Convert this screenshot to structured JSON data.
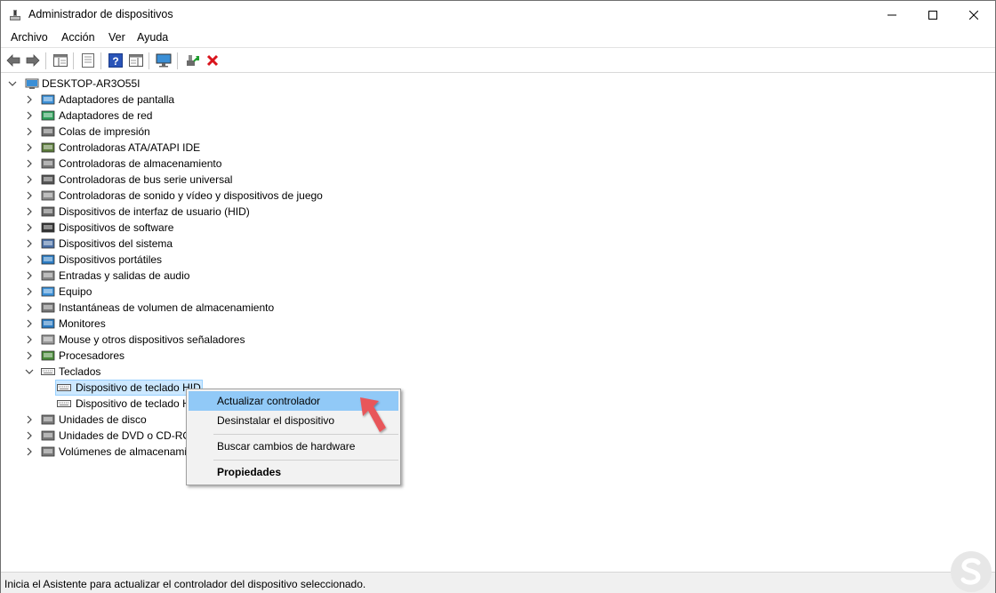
{
  "window": {
    "title": "Administrador de dispositivos"
  },
  "menu": [
    "Archivo",
    "Acción",
    "Ver",
    "Ayuda"
  ],
  "toolbar": {
    "buttons": [
      "back-icon",
      "forward-icon",
      "show-hide-console-tree-icon",
      "properties-icon",
      "help-icon",
      "action-pane-icon",
      "monitor-icon",
      "update-driver-icon",
      "uninstall-icon"
    ]
  },
  "tree": {
    "root": "DESKTOP-AR3O55I",
    "categories": [
      "Adaptadores de pantalla",
      "Adaptadores de red",
      "Colas de impresión",
      "Controladoras ATA/ATAPI IDE",
      "Controladoras de almacenamiento",
      "Controladoras de bus serie universal",
      "Controladoras de sonido y vídeo y dispositivos de juego",
      "Dispositivos de interfaz de usuario (HID)",
      "Dispositivos de software",
      "Dispositivos del sistema",
      "Dispositivos portátiles",
      "Entradas y salidas de audio",
      "Equipo",
      "Instantáneas de volumen de almacenamiento",
      "Monitores",
      "Mouse y otros dispositivos señaladores",
      "Procesadores",
      "Teclados"
    ],
    "keyboard_children": [
      "Dispositivo de teclado HID",
      "Dispositivo de teclado H"
    ],
    "after": [
      "Unidades de disco",
      "Unidades de DVD o CD-ROM",
      "Volúmenes de almacenami"
    ]
  },
  "context_menu": {
    "items": [
      "Actualizar controlador",
      "Desinstalar el dispositivo",
      "Buscar cambios de hardware",
      "Propiedades"
    ]
  },
  "status": {
    "text": "Inicia el Asistente para actualizar el controlador del dispositivo seleccionado."
  },
  "colors": {
    "selection": "#cce8ff",
    "menu_highlight": "#91c9f7",
    "arrow": "#e8565a",
    "uninstall": "#d9141c"
  }
}
